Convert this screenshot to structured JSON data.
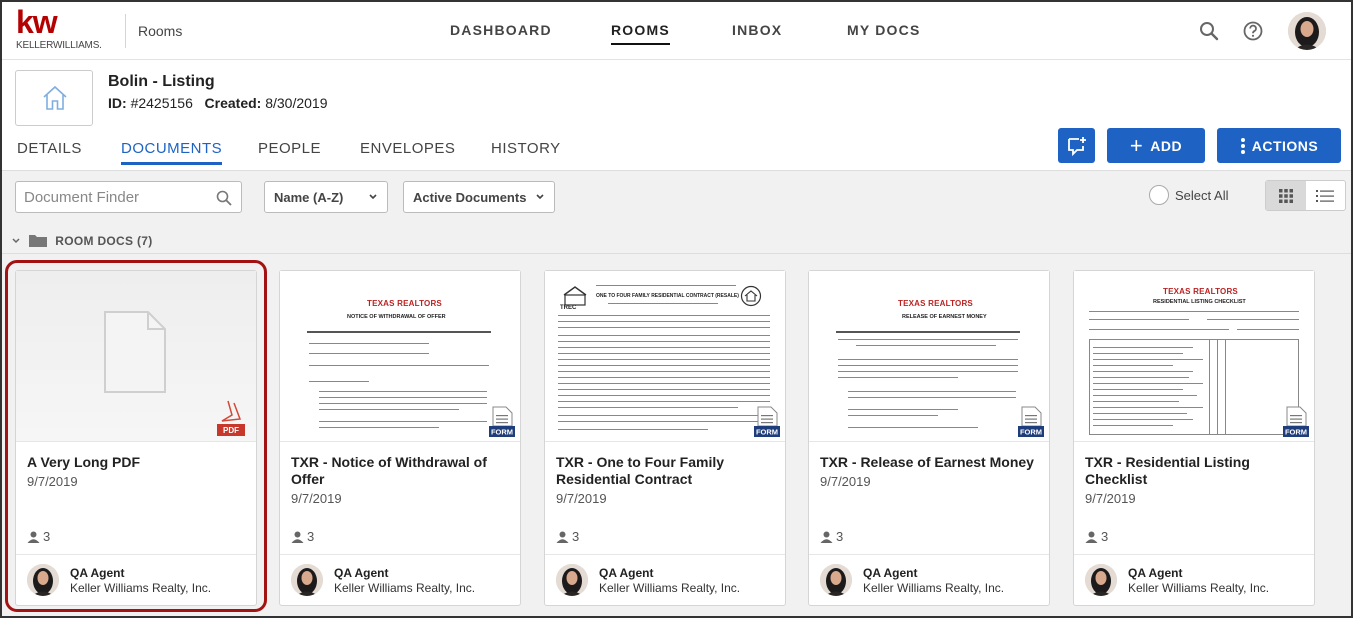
{
  "header": {
    "logo_mark": "kw",
    "logo_sub": "KELLERWILLIAMS.",
    "app_name": "Rooms",
    "nav": [
      {
        "label": "DASHBOARD"
      },
      {
        "label": "ROOMS",
        "active": true
      },
      {
        "label": "INBOX"
      },
      {
        "label": "MY DOCS"
      }
    ]
  },
  "room": {
    "title": "Bolin - Listing",
    "id_label": "ID:",
    "id_value": "#2425156",
    "created_label": "Created:",
    "created_value": "8/30/2019"
  },
  "tabs": [
    {
      "label": "DETAILS"
    },
    {
      "label": "DOCUMENTS",
      "active": true
    },
    {
      "label": "PEOPLE"
    },
    {
      "label": "ENVELOPES"
    },
    {
      "label": "HISTORY"
    }
  ],
  "actions": {
    "add_label": "ADD",
    "actions_label": "ACTIONS"
  },
  "toolbar": {
    "finder_placeholder": "Document Finder",
    "sort_value": "Name (A-Z)",
    "filter_value": "Active Documents",
    "select_all_label": "Select All"
  },
  "group": {
    "label": "ROOM DOCS (7)"
  },
  "cards": [
    {
      "title": "A Very Long PDF",
      "date": "9/7/2019",
      "people_count": "3",
      "agent": "QA Agent",
      "company": "Keller Williams Realty, Inc.",
      "badge": "PDF"
    },
    {
      "title": "TXR - Notice of Withdrawal of Offer",
      "date": "9/7/2019",
      "people_count": "3",
      "agent": "QA Agent",
      "company": "Keller Williams Realty, Inc.",
      "badge": "FORM",
      "doc_logo": "TEXAS REALTORS",
      "doc_heading": "NOTICE OF WITHDRAWAL OF OFFER"
    },
    {
      "title": "TXR - One to Four Family Residential Contract",
      "date": "9/7/2019",
      "people_count": "3",
      "agent": "QA Agent",
      "company": "Keller Williams Realty, Inc.",
      "badge": "FORM",
      "doc_logo": "TREC",
      "doc_heading": "ONE TO FOUR FAMILY RESIDENTIAL CONTRACT (RESALE)"
    },
    {
      "title": "TXR - Release of Earnest Money",
      "date": "9/7/2019",
      "people_count": "3",
      "agent": "QA Agent",
      "company": "Keller Williams Realty, Inc.",
      "badge": "FORM",
      "doc_logo": "TEXAS REALTORS",
      "doc_heading": "RELEASE OF EARNEST MONEY"
    },
    {
      "title": "TXR - Residential Listing Checklist",
      "date": "9/7/2019",
      "people_count": "3",
      "agent": "QA Agent",
      "company": "Keller Williams Realty, Inc.",
      "badge": "FORM",
      "doc_logo": "TEXAS REALTORS",
      "doc_heading": "RESIDENTIAL LISTING CHECKLIST"
    }
  ],
  "colors": {
    "brand_red": "#b40101",
    "accent_blue": "#1e63c4",
    "selection_ring": "#a31313"
  }
}
